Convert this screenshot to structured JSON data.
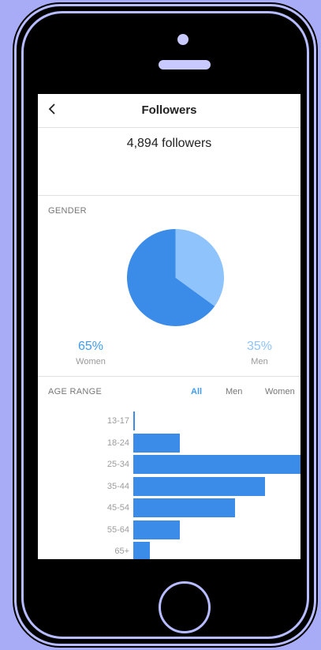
{
  "nav": {
    "title": "Followers"
  },
  "summary": {
    "followers_text": "4,894 followers"
  },
  "gender": {
    "section_label": "GENDER",
    "women_pct": "65%",
    "women_label": "Women",
    "men_pct": "35%",
    "men_label": "Men",
    "women_fraction": 0.65,
    "men_fraction": 0.35,
    "women_color": "#3b8ce8",
    "men_color": "#8ec4fb"
  },
  "age_range": {
    "section_label": "AGE RANGE",
    "filters": [
      "All",
      "Men",
      "Women"
    ],
    "active_filter": "All",
    "bar_color": "#3b8ce8",
    "rows": [
      {
        "label": "13-17",
        "value": 1
      },
      {
        "label": "18-24",
        "value": 28
      },
      {
        "label": "25-34",
        "value": 100
      },
      {
        "label": "35-44",
        "value": 79
      },
      {
        "label": "45-54",
        "value": 61
      },
      {
        "label": "55-64",
        "value": 28
      },
      {
        "label": "65+",
        "value": 10
      }
    ]
  }
}
